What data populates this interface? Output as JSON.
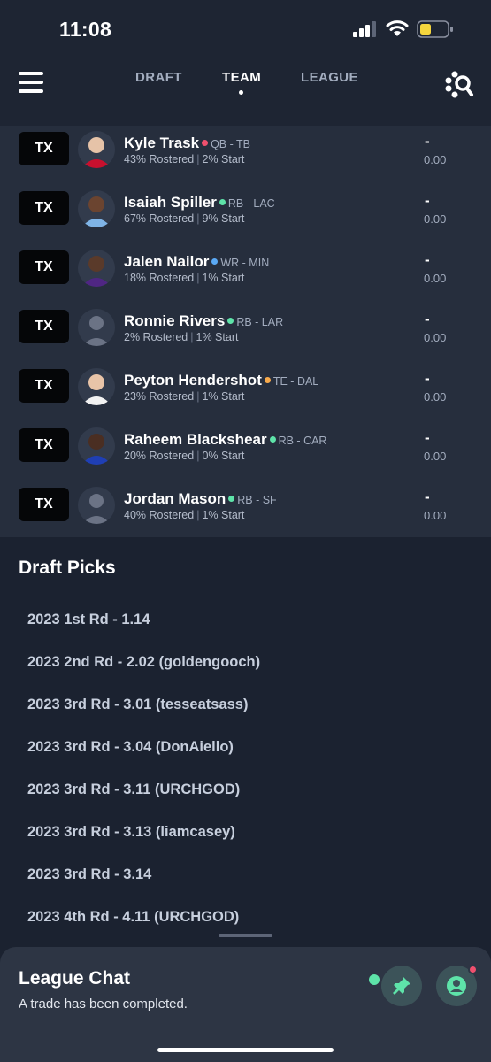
{
  "status_bar": {
    "time": "11:08"
  },
  "nav": {
    "tabs": [
      {
        "label": "DRAFT",
        "active": false
      },
      {
        "label": "TEAM",
        "active": true
      },
      {
        "label": "LEAGUE",
        "active": false
      }
    ]
  },
  "roster": {
    "players": [
      {
        "button": "TX",
        "name": "Kyle Trask",
        "pos": "QB - TB",
        "dot_color": "#f0506e",
        "rostered": "43% Rostered",
        "start": "2% Start",
        "proj": "-",
        "pts": "0.00"
      },
      {
        "button": "TX",
        "name": "Isaiah Spiller",
        "pos": "RB - LAC",
        "dot_color": "#5ee3a9",
        "rostered": "67% Rostered",
        "start": "9% Start",
        "proj": "-",
        "pts": "0.00"
      },
      {
        "button": "TX",
        "name": "Jalen Nailor",
        "pos": "WR - MIN",
        "dot_color": "#5aa9f5",
        "rostered": "18% Rostered",
        "start": "1% Start",
        "proj": "-",
        "pts": "0.00"
      },
      {
        "button": "TX",
        "name": "Ronnie Rivers",
        "pos": "RB - LAR",
        "dot_color": "#5ee3a9",
        "rostered": "2% Rostered",
        "start": "1% Start",
        "proj": "-",
        "pts": "0.00"
      },
      {
        "button": "TX",
        "name": "Peyton Hendershot",
        "pos": "TE - DAL",
        "dot_color": "#f7a94b",
        "rostered": "23% Rostered",
        "start": "1% Start",
        "proj": "-",
        "pts": "0.00"
      },
      {
        "button": "TX",
        "name": "Raheem Blackshear",
        "pos": "RB - CAR",
        "dot_color": "#5ee3a9",
        "rostered": "20% Rostered",
        "start": "0% Start",
        "proj": "-",
        "pts": "0.00"
      },
      {
        "button": "TX",
        "name": "Jordan Mason",
        "pos": "RB - SF",
        "dot_color": "#5ee3a9",
        "rostered": "40% Rostered",
        "start": "1% Start",
        "proj": "-",
        "pts": "0.00"
      }
    ]
  },
  "draft_picks": {
    "title": "Draft Picks",
    "items": [
      "2023 1st Rd - 1.14",
      "2023 2nd Rd - 2.02 (goldengooch)",
      "2023 3rd Rd - 3.01 (tesseatsass)",
      "2023 3rd Rd - 3.04 (DonAiello)",
      "2023 3rd Rd - 3.11 (URCHGOD)",
      "2023 3rd Rd - 3.13 (liamcasey)",
      "2023 3rd Rd - 3.14",
      "2023 4th Rd - 4.11 (URCHGOD)"
    ]
  },
  "chat": {
    "title": "League Chat",
    "message": "A trade has been completed."
  },
  "colors": {
    "background": "#1b2230",
    "roster_bg": "#262e3d",
    "accent_green": "#5ee3a9",
    "alert_red": "#f0506e"
  },
  "icons": [
    "menu-icon",
    "search-players-icon",
    "pin-icon",
    "profile-icon"
  ]
}
